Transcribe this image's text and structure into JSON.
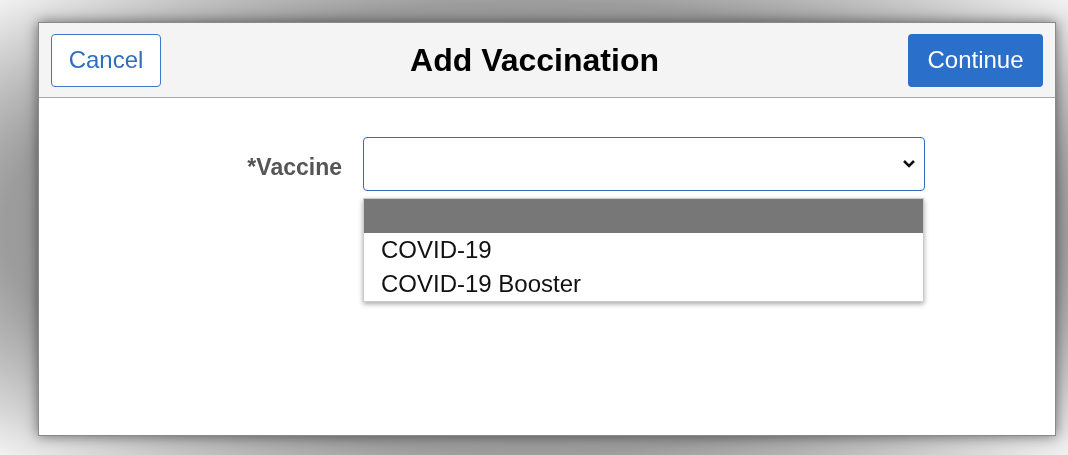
{
  "dialog": {
    "title": "Add Vaccination",
    "cancel_button": "Cancel",
    "continue_button": "Continue"
  },
  "vaccine_field": {
    "label": "*Vaccine",
    "expanded": true,
    "options": [
      {
        "selected": true
      },
      {
        "label": "COVID-19",
        "selected": false
      },
      {
        "label": "COVID-19 Booster",
        "selected": false
      }
    ]
  }
}
